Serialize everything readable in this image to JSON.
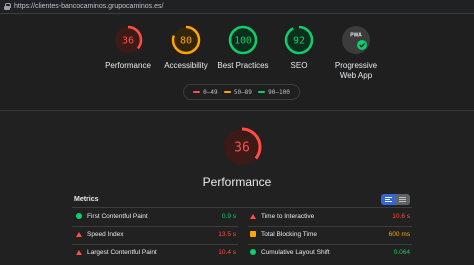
{
  "browser": {
    "url": "https://clientes-bancocaminos.grupocaminos.es/"
  },
  "colors": {
    "fail": "#ff4e42",
    "average": "#ffa400",
    "pass": "#0cce6b",
    "pwa": "#e8eaed"
  },
  "gauges": [
    {
      "score": "36",
      "value": 36,
      "label": "Performance",
      "status": "fail"
    },
    {
      "score": "80",
      "value": 80,
      "label": "Accessibility",
      "status": "average"
    },
    {
      "score": "100",
      "value": 100,
      "label": "Best Practices",
      "status": "pass"
    },
    {
      "score": "92",
      "value": 92,
      "label": "SEO",
      "status": "pass"
    },
    {
      "score": "PWA",
      "label_line1": "Progressive",
      "label_line2": "Web App",
      "icon": "pwa-badge-icon"
    }
  ],
  "legend": [
    {
      "label": "0–49",
      "status": "fail"
    },
    {
      "label": "50–89",
      "status": "average"
    },
    {
      "label": "90–100",
      "status": "pass"
    }
  ],
  "performance": {
    "score": "36",
    "value": 36,
    "title": "Performance"
  },
  "metrics": {
    "heading": "Metrics",
    "items": [
      {
        "name": "First Contentful Paint",
        "value": "0.9 s",
        "status": "pass",
        "icon": "circle-icon"
      },
      {
        "name": "Time to Interactive",
        "value": "10.6 s",
        "status": "fail",
        "icon": "triangle-icon"
      },
      {
        "name": "Speed Index",
        "value": "13.5 s",
        "status": "fail",
        "icon": "triangle-icon"
      },
      {
        "name": "Total Blocking Time",
        "value": "600 ms",
        "status": "average",
        "icon": "square-icon"
      },
      {
        "name": "Largest Contentful Paint",
        "value": "10.4 s",
        "status": "fail",
        "icon": "triangle-icon"
      },
      {
        "name": "Cumulative Layout Shift",
        "value": "0.064",
        "status": "pass",
        "icon": "circle-icon"
      }
    ]
  },
  "view_toggle": {
    "icons": [
      "list-view-icon",
      "detail-view-icon"
    ]
  }
}
